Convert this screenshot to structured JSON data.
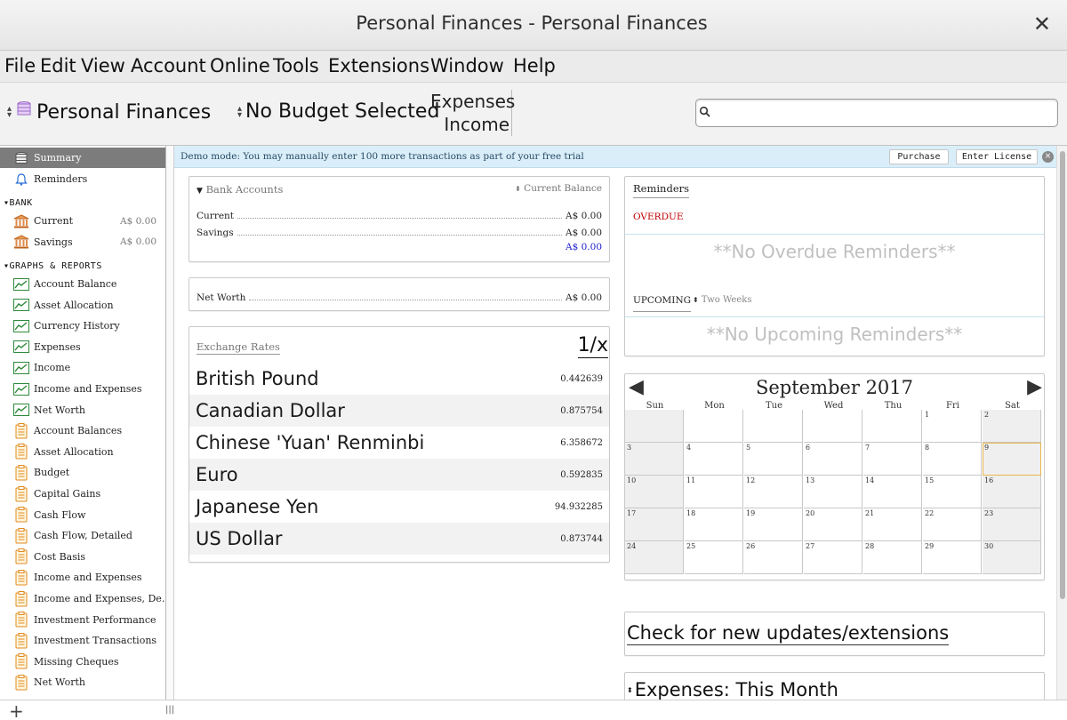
{
  "window": {
    "title": "Personal Finances - Personal Finances",
    "close_glyph": "✕"
  },
  "menu": [
    "File",
    "Edit",
    "View",
    "Account",
    "Online",
    "Tools",
    "Extensions",
    "Window",
    "Help"
  ],
  "toolbar": {
    "account_label": "Personal Finances",
    "budget_label": "No Budget Selected",
    "expenses_label": "Expenses",
    "income_label": "Income",
    "search_value": ""
  },
  "sidebar": {
    "top_items": [
      {
        "label": "Summary",
        "icon": "summary-icon",
        "selected": true
      },
      {
        "label": "Reminders",
        "icon": "bell-icon"
      }
    ],
    "bank_header": "▾BANK",
    "bank_accounts": [
      {
        "label": "Current",
        "amount": "A$ 0.00"
      },
      {
        "label": "Savings",
        "amount": "A$ 0.00"
      }
    ],
    "reports_header": "▾GRAPHS & REPORTS",
    "graphs": [
      "Account Balance",
      "Asset Allocation",
      "Currency History",
      "Expenses",
      "Income",
      "Income and Expenses",
      "Net Worth"
    ],
    "reports": [
      "Account Balances",
      "Asset Allocation",
      "Budget",
      "Capital Gains",
      "Cash Flow",
      "Cash Flow, Detailed",
      "Cost Basis",
      "Income and Expenses",
      "Income and Expenses, De...",
      "Investment Performance",
      "Investment Transactions",
      "Missing Cheques",
      "Net Worth"
    ]
  },
  "bottombar": {
    "add_glyph": "+",
    "grip_glyph": "|||"
  },
  "demo": {
    "message": "Demo mode:  You may manually enter 100 more transactions as part of your free trial",
    "purchase_label": "Purchase",
    "license_label": "Enter License",
    "close_glyph": "×"
  },
  "bank_card": {
    "title": "Bank Accounts",
    "balance_selector": "Current Balance",
    "rows": [
      {
        "label": "Current",
        "value": "A$ 0.00"
      },
      {
        "label": "Savings",
        "value": "A$ 0.00"
      }
    ],
    "total": "A$ 0.00"
  },
  "networth_card": {
    "label": "Net Worth",
    "value": "A$ 0.00"
  },
  "fx_card": {
    "title": "Exchange Rates",
    "invert_label": "1/x",
    "rates": [
      {
        "currency": "British Pound",
        "rate": "0.442639"
      },
      {
        "currency": "Canadian Dollar",
        "rate": "0.875754"
      },
      {
        "currency": "Chinese 'Yuan' Renminbi",
        "rate": "6.358672"
      },
      {
        "currency": "Euro",
        "rate": "0.592835"
      },
      {
        "currency": "Japanese Yen",
        "rate": "94.932285"
      },
      {
        "currency": "US Dollar",
        "rate": "0.873744"
      }
    ]
  },
  "reminders_card": {
    "title": "Reminders",
    "overdue_label": "OVERDUE",
    "no_overdue": "**No Overdue Reminders**",
    "upcoming_label": "UPCOMING",
    "period": "Two Weeks",
    "no_upcoming": "**No Upcoming Reminders**"
  },
  "calendar": {
    "month_label": "September 2017",
    "prev_glyph": "◀",
    "next_glyph": "▶",
    "weekdays": [
      "Sun",
      "Mon",
      "Tue",
      "Wed",
      "Thu",
      "Fri",
      "Sat"
    ],
    "first_weekday": 5,
    "days_in_month": 30,
    "today": 9
  },
  "updates_link": "Check for new updates/extensions",
  "expenses_widget": "Expenses: This Month",
  "colors": {
    "overdue": "#c00000",
    "link_total": "#1a1acc",
    "demo_bg": "#d9eef8",
    "selected_row": "#7c7c7c",
    "icon_green": "#2f8a3a",
    "icon_orange": "#e08a1c"
  }
}
